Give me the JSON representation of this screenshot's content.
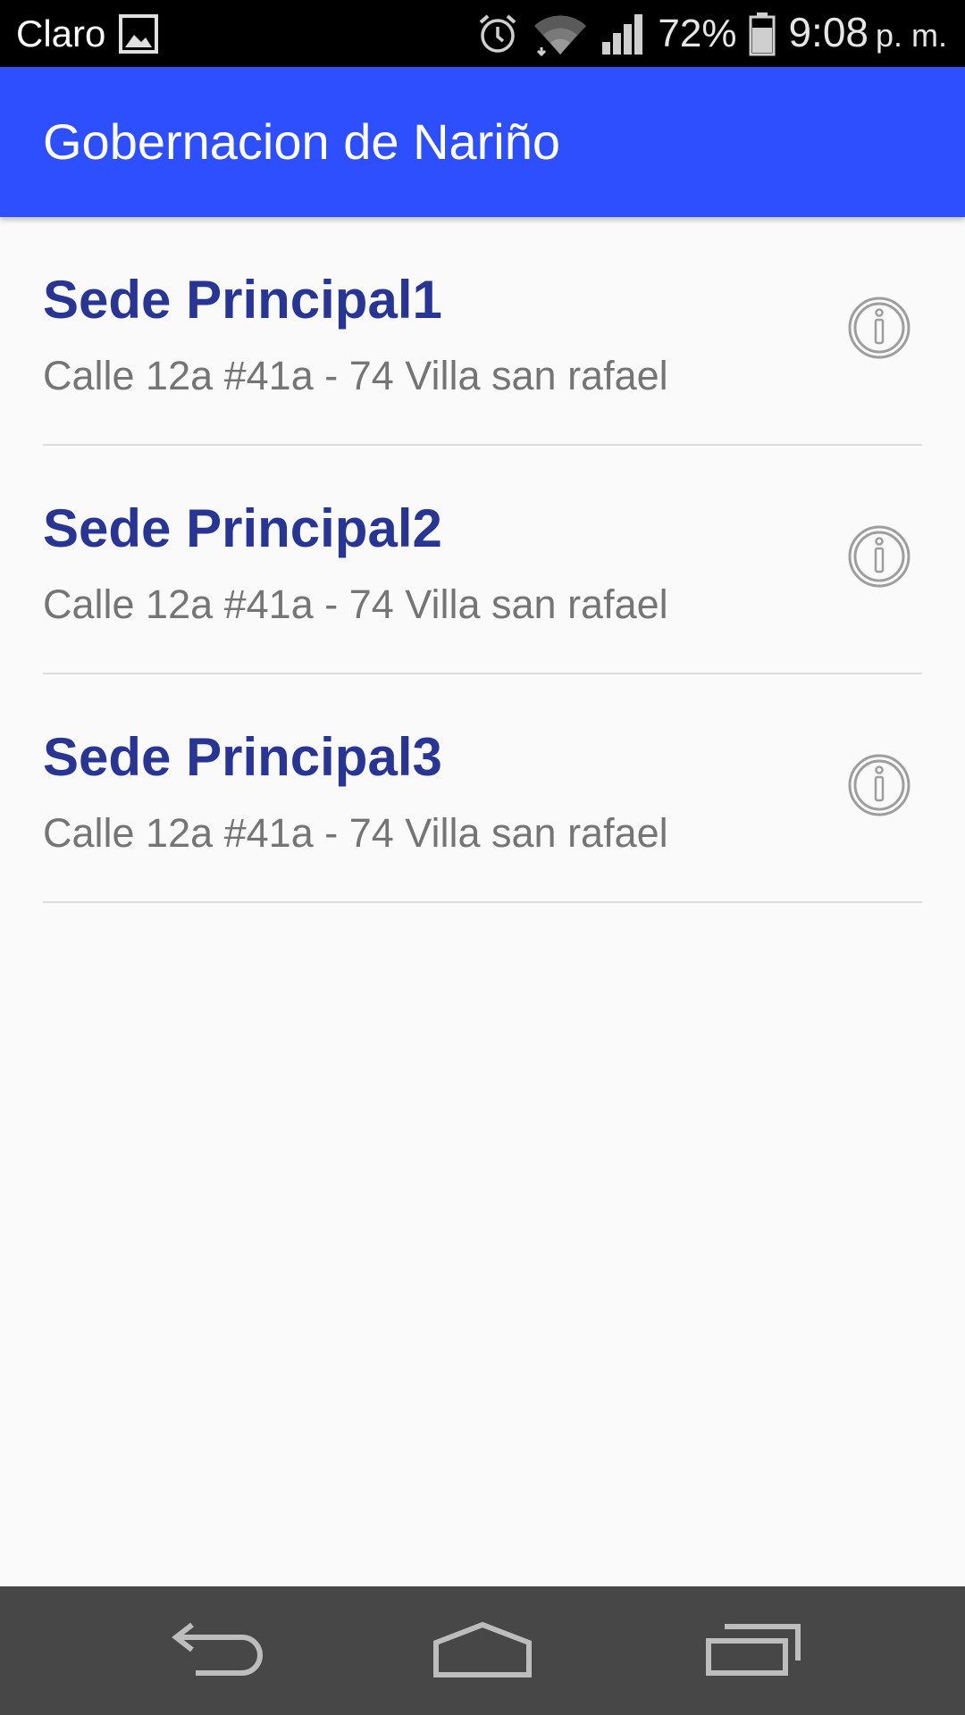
{
  "status_bar": {
    "carrier": "Claro",
    "battery_percent": "72%",
    "time": "9:08",
    "ampm": "p. m.",
    "icons": [
      "image-notification-icon",
      "alarm-icon",
      "wifi-icon",
      "signal-icon",
      "battery-icon"
    ]
  },
  "app_bar": {
    "title": "Gobernacion de Nariño",
    "color": "#2e4ffd"
  },
  "list": {
    "items": [
      {
        "title": "Sede Principal1",
        "subtitle": "Calle 12a #41a - 74 Villa san rafael",
        "action_icon": "info-icon"
      },
      {
        "title": "Sede Principal2",
        "subtitle": "Calle 12a #41a - 74 Villa san rafael",
        "action_icon": "info-icon"
      },
      {
        "title": "Sede Principal3",
        "subtitle": "Calle 12a #41a - 74 Villa san rafael",
        "action_icon": "info-icon"
      }
    ],
    "title_color": "#283593",
    "subtitle_color": "#757575"
  },
  "nav_bar": {
    "buttons": [
      "back-icon",
      "home-icon",
      "recents-icon"
    ]
  }
}
